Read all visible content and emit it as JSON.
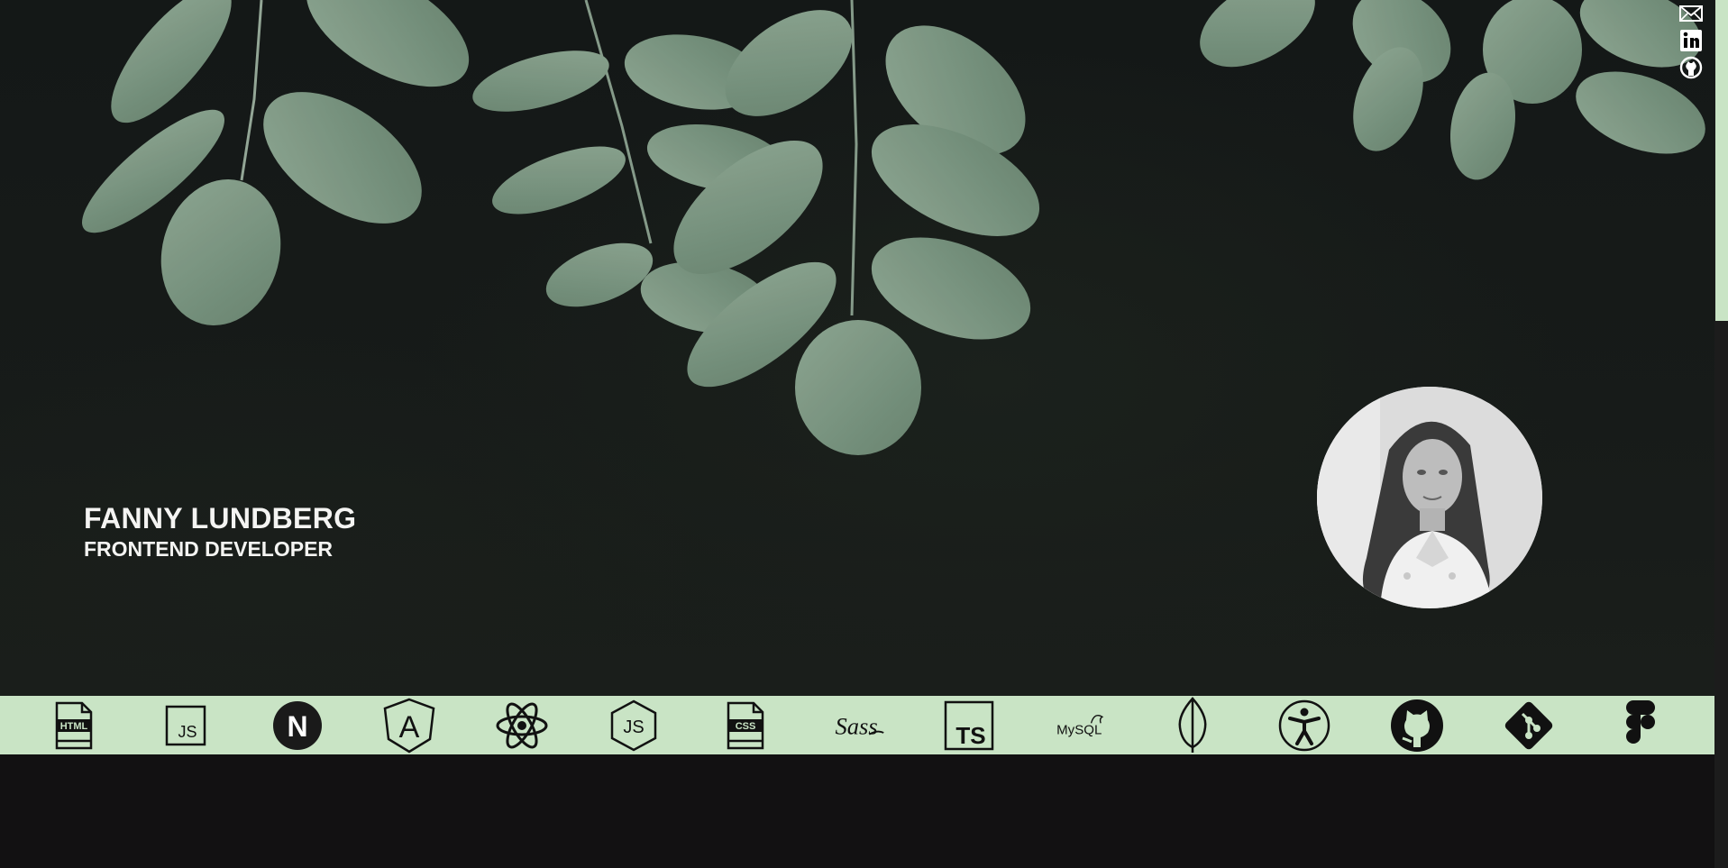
{
  "profile": {
    "name": "FANNY LUNDBERG",
    "role": "FRONTEND DEVELOPER"
  },
  "social": [
    {
      "icon": "mail-icon"
    },
    {
      "icon": "linkedin-icon"
    },
    {
      "icon": "github-icon"
    }
  ],
  "tech_icons": [
    {
      "icon": "html-file-icon",
      "label": "HTML"
    },
    {
      "icon": "js-square-icon",
      "label": "JS"
    },
    {
      "icon": "nextjs-icon",
      "label": "N"
    },
    {
      "icon": "angular-icon",
      "label": "A"
    },
    {
      "icon": "react-icon"
    },
    {
      "icon": "nodejs-icon",
      "label": "JS"
    },
    {
      "icon": "css-file-icon",
      "label": "CSS"
    },
    {
      "icon": "sass-icon",
      "label": "Sass"
    },
    {
      "icon": "typescript-icon",
      "label": "TS"
    },
    {
      "icon": "mysql-icon",
      "label": "MySQL"
    },
    {
      "icon": "mongodb-leaf-icon"
    },
    {
      "icon": "accessibility-icon"
    },
    {
      "icon": "github-octocat-icon"
    },
    {
      "icon": "git-icon"
    },
    {
      "icon": "figma-icon"
    }
  ],
  "colors": {
    "accent": "#c9e4c5",
    "background": "#121112",
    "leaf": "#7e9a86",
    "text": "#f4f4f2"
  }
}
